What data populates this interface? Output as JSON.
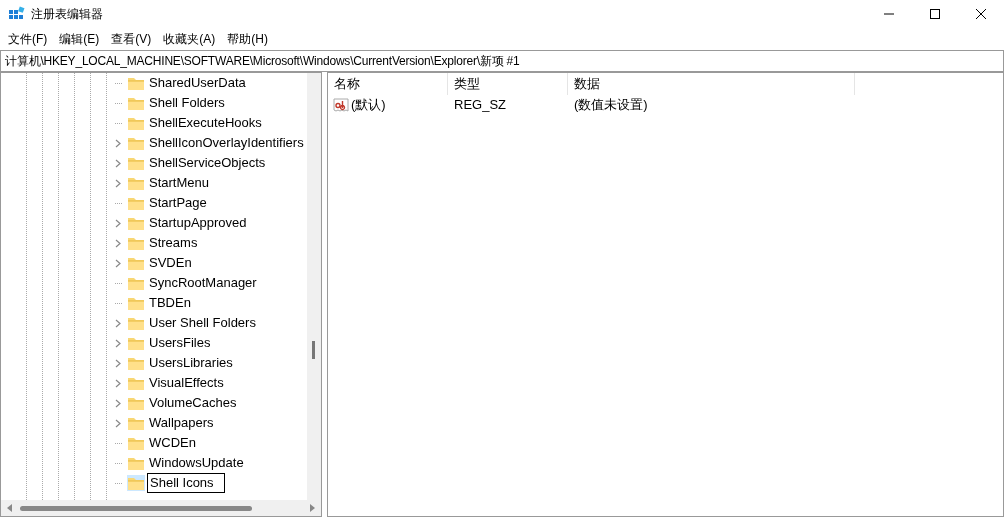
{
  "window": {
    "title": "注册表编辑器"
  },
  "menu": [
    "文件(F)",
    "编辑(E)",
    "查看(V)",
    "收藏夹(A)",
    "帮助(H)"
  ],
  "address": "计算机\\HKEY_LOCAL_MACHINE\\SOFTWARE\\Microsoft\\Windows\\CurrentVersion\\Explorer\\新项 #1",
  "tree": [
    {
      "name": "SharedUserData",
      "expandable": false
    },
    {
      "name": "Shell Folders",
      "expandable": false
    },
    {
      "name": "ShellExecuteHooks",
      "expandable": false
    },
    {
      "name": "ShellIconOverlayIdentifiers",
      "expandable": true
    },
    {
      "name": "ShellServiceObjects",
      "expandable": true
    },
    {
      "name": "StartMenu",
      "expandable": true
    },
    {
      "name": "StartPage",
      "expandable": false
    },
    {
      "name": "StartupApproved",
      "expandable": true
    },
    {
      "name": "Streams",
      "expandable": true
    },
    {
      "name": "SVDEn",
      "expandable": true
    },
    {
      "name": "SyncRootManager",
      "expandable": false
    },
    {
      "name": "TBDEn",
      "expandable": false
    },
    {
      "name": "User Shell Folders",
      "expandable": true
    },
    {
      "name": "UsersFiles",
      "expandable": true
    },
    {
      "name": "UsersLibraries",
      "expandable": true
    },
    {
      "name": "VisualEffects",
      "expandable": true
    },
    {
      "name": "VolumeCaches",
      "expandable": true
    },
    {
      "name": "Wallpapers",
      "expandable": true
    },
    {
      "name": "WCDEn",
      "expandable": false
    },
    {
      "name": "WindowsUpdate",
      "expandable": false
    },
    {
      "name": "Shell Icons",
      "expandable": false,
      "editing": true
    }
  ],
  "table": {
    "columns": [
      "名称",
      "类型",
      "数据"
    ],
    "rows": [
      {
        "name": "(默认)",
        "type": "REG_SZ",
        "data": "(数值未设置)"
      }
    ]
  }
}
